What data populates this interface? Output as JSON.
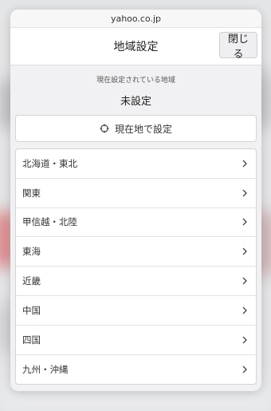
{
  "browser": {
    "url": "yahoo.co.jp"
  },
  "header": {
    "title": "地域設定",
    "close_label": "閉じる"
  },
  "current": {
    "caption": "現在設定されている地域",
    "value": "未設定"
  },
  "locate": {
    "label": "現在地で設定",
    "icon": "crosshair-icon"
  },
  "regions": [
    {
      "label": "北海道・東北"
    },
    {
      "label": "関東"
    },
    {
      "label": "甲信越・北陸"
    },
    {
      "label": "東海"
    },
    {
      "label": "近畿"
    },
    {
      "label": "中国"
    },
    {
      "label": "四国"
    },
    {
      "label": "九州・沖縄"
    }
  ],
  "colors": {
    "sheet_bg": "#f1f1f3",
    "list_bg": "#ffffff",
    "text": "#333333"
  }
}
